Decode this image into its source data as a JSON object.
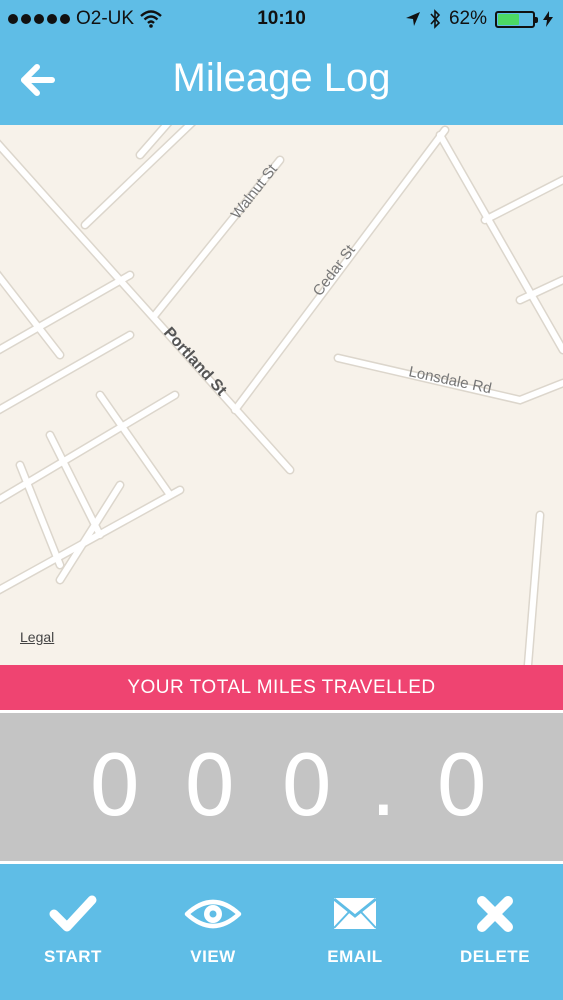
{
  "status_bar": {
    "carrier": "O2-UK",
    "time": "10:10",
    "battery_percent": "62%",
    "battery_level": 0.62,
    "signal_bars": 5,
    "icons": [
      "wifi-icon",
      "location-arrow-icon",
      "bluetooth-icon",
      "battery-icon",
      "charging-bolt-icon"
    ]
  },
  "navbar": {
    "title": "Mileage Log",
    "back_icon": "arrow-left-icon"
  },
  "map": {
    "streets": [
      "Walnut St",
      "Portland St",
      "Cedar St",
      "Lonsdale Rd"
    ],
    "legal_label": "Legal",
    "colors": {
      "background": "#f7f2ea",
      "road": "#ffffff",
      "road_edge": "#dcd6cc"
    }
  },
  "banner": {
    "text": "YOUR TOTAL MILES TRAVELLED"
  },
  "odometer": {
    "digits": [
      "0",
      "0",
      "0",
      ".",
      "0"
    ]
  },
  "toolbar": {
    "items": [
      {
        "label": "START",
        "icon": "checkmark-icon"
      },
      {
        "label": "VIEW",
        "icon": "eye-icon"
      },
      {
        "label": "EMAIL",
        "icon": "envelope-icon"
      },
      {
        "label": "DELETE",
        "icon": "x-icon"
      }
    ]
  },
  "colors": {
    "accent": "#5fbde6",
    "banner": "#ef4471",
    "odometer_bg": "#c4c4c4",
    "text_light": "#ffffff"
  }
}
